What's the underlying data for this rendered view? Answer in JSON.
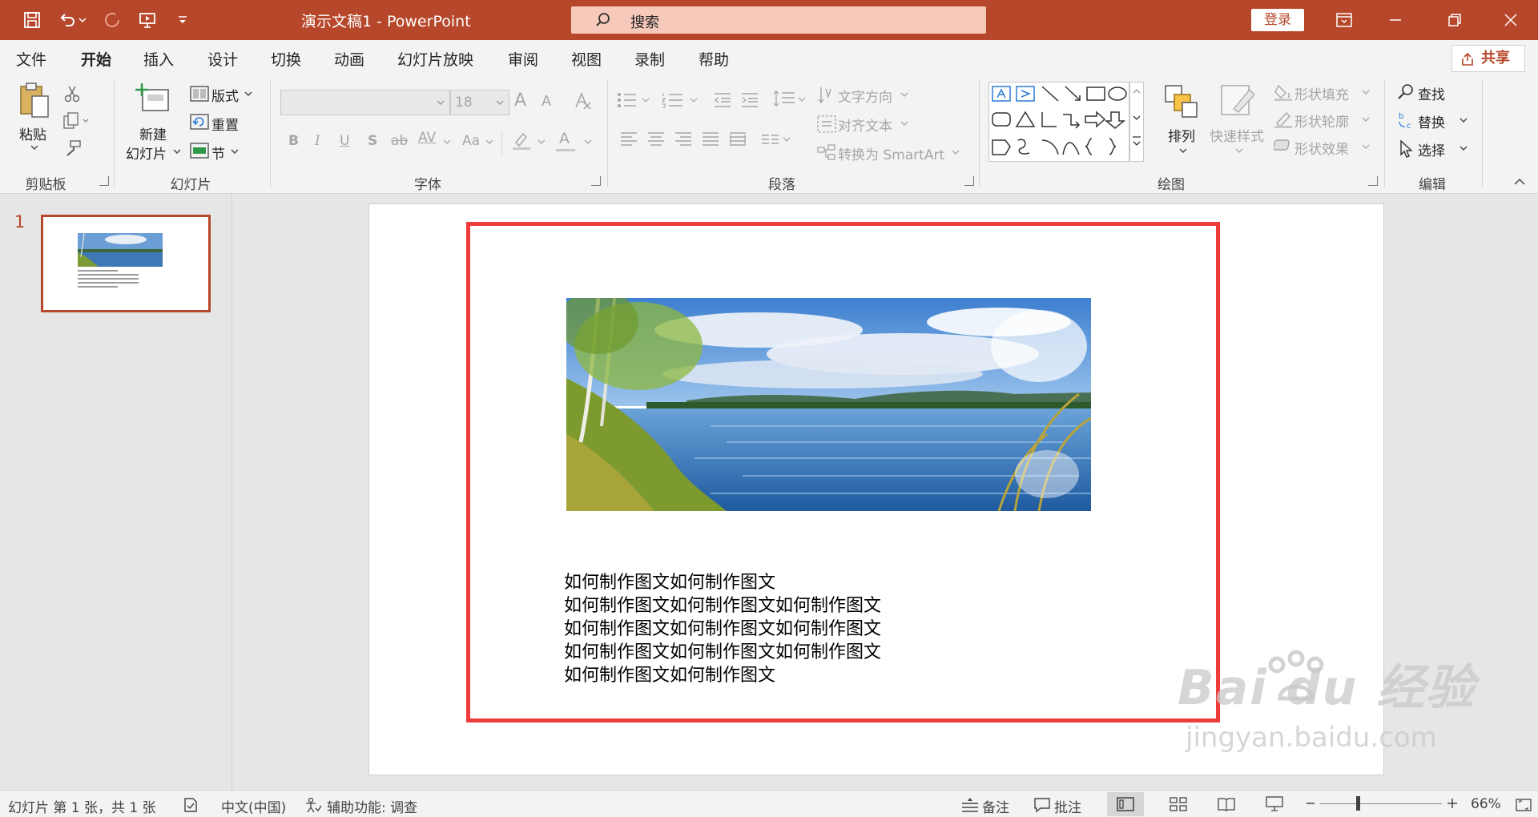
{
  "title_bar": {
    "doc_title": "演示文稿1  -  PowerPoint",
    "search_text": "搜索",
    "login_label": "登录"
  },
  "menu": {
    "tabs": [
      "文件",
      "开始",
      "插入",
      "设计",
      "切换",
      "动画",
      "幻灯片放映",
      "审阅",
      "视图",
      "录制",
      "帮助"
    ],
    "active": "开始",
    "share_label": "共享"
  },
  "ribbon": {
    "clipboard": {
      "paste": "粘贴",
      "label": "剪贴板"
    },
    "slides": {
      "new_slide_1": "新建",
      "new_slide_2": "幻灯片",
      "layout": "版式",
      "reset": "重置",
      "section": "节",
      "label": "幻灯片"
    },
    "font": {
      "size": "18",
      "label": "字体",
      "bold": "B",
      "italic": "I",
      "underline": "U",
      "shadow": "S",
      "strike": "ab",
      "spacing": "AV",
      "case": "Aa",
      "grow": "A",
      "shrink": "A",
      "color": "A"
    },
    "paragraph": {
      "text_direction": "文字方向",
      "align_text": "对齐文本",
      "smartart": "转换为 SmartArt",
      "label": "段落"
    },
    "drawing": {
      "arrange": "排列",
      "quick_styles": "快速样式",
      "fill": "形状填充",
      "outline": "形状轮廓",
      "effects": "形状效果",
      "label": "绘图"
    },
    "editing": {
      "find": "查找",
      "replace": "替换",
      "select": "选择",
      "label": "编辑"
    }
  },
  "slides_panel": {
    "slide_number": "1"
  },
  "slide": {
    "body_lines": [
      "如何制作图文如何制作图文",
      "如何制作图文如何制作图文如何制作图文",
      "如何制作图文如何制作图文如何制作图文",
      "如何制作图文如何制作图文如何制作图文",
      "如何制作图文如何制作图文"
    ]
  },
  "status": {
    "slide_info": "幻灯片 第 1 张，共 1 张",
    "language": "中文(中国)",
    "accessibility": "辅助功能: 调查",
    "notes": "备注",
    "comments": "批注",
    "zoom": "66%",
    "zoom_level": 0.66
  },
  "watermark": {
    "brand": "Bai du 经验",
    "url": "jingyan.baidu.com"
  },
  "colors": {
    "accent": "#b7472a",
    "red_box": "#ee3b3b"
  }
}
